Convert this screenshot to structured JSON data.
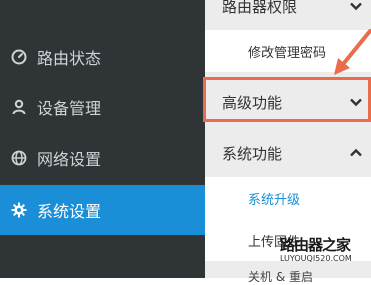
{
  "sidebar": {
    "items": [
      {
        "label": "路由状态",
        "icon": "dashboard-gauge-icon",
        "active": false
      },
      {
        "label": "设备管理",
        "icon": "user-icon",
        "active": false
      },
      {
        "label": "网络设置",
        "icon": "globe-icon",
        "active": false
      },
      {
        "label": "系统设置",
        "icon": "gear-icon",
        "active": true
      }
    ]
  },
  "panel": {
    "top_section": {
      "title": "路由器权限",
      "expanded": false
    },
    "top_sub_item": "修改管理密码",
    "advanced": {
      "title": "高级功能",
      "expanded": false
    },
    "system": {
      "title": "系统功能",
      "expanded": true
    },
    "system_items": [
      "系统升级",
      "上传固件",
      "关机 & 重启"
    ]
  },
  "watermark": {
    "main": "路由器之家",
    "sub": "LUYOUQI520.COM"
  },
  "colors": {
    "sidebar_bg": "#2f3437",
    "accent_blue": "#1a8fd8",
    "panel_bg": "#ececec",
    "highlight_orange": "#ea6d4b"
  }
}
